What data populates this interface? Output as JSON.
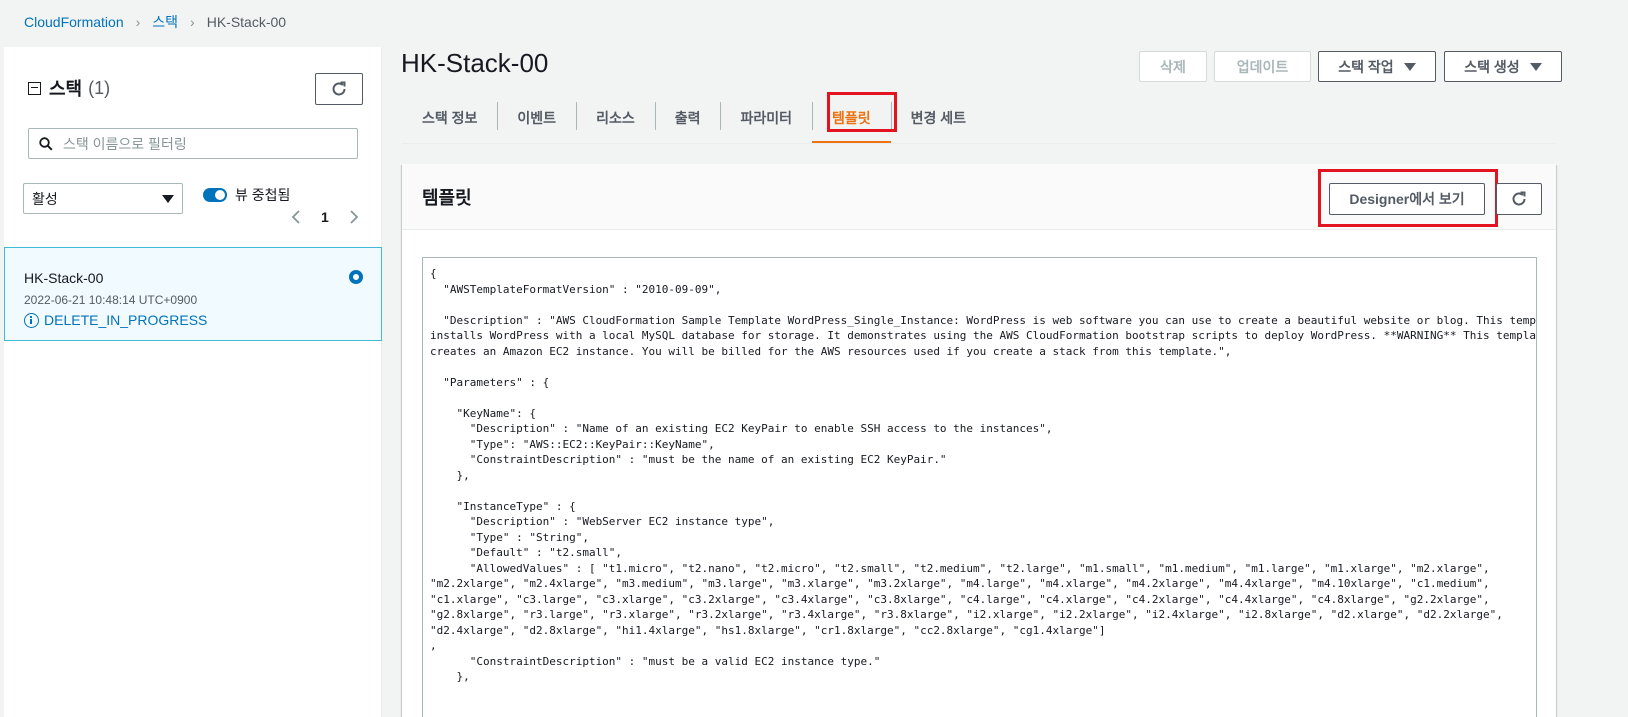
{
  "breadcrumb": {
    "root": "CloudFormation",
    "stacks": "스택",
    "current": "HK-Stack-00"
  },
  "left_panel": {
    "title": "스택",
    "count": "(1)",
    "search_placeholder": "스택 이름으로 필터링",
    "filter_select": "활성",
    "toggle_label": "뷰 중첩됨",
    "toggle_on": true,
    "page_number": "1",
    "stack": {
      "name": "HK-Stack-00",
      "date": "2022-06-21 10:48:14 UTC+0900",
      "status": "DELETE_IN_PROGRESS",
      "selected": true
    }
  },
  "main": {
    "title": "HK-Stack-00",
    "buttons": {
      "delete": "삭제",
      "update": "업데이트",
      "stack_actions": "스택 작업",
      "create_stack": "스택 생성"
    },
    "tabs": [
      {
        "label": "스택 정보"
      },
      {
        "label": "이벤트"
      },
      {
        "label": "리소스"
      },
      {
        "label": "출력"
      },
      {
        "label": "파라미터"
      },
      {
        "label": "템플릿",
        "active": true
      },
      {
        "label": "변경 세트"
      }
    ],
    "template": {
      "title": "템플릿",
      "designer_button": "Designer에서 보기",
      "code_lines": [
        "{",
        "  \"AWSTemplateFormatVersion\" : \"2010-09-09\",",
        "",
        "  \"Description\" : \"AWS CloudFormation Sample Template WordPress_Single_Instance: WordPress is web software you can use to create a beautiful website or blog. This template",
        "installs WordPress with a local MySQL database for storage. It demonstrates using the AWS CloudFormation bootstrap scripts to deploy WordPress. **WARNING** This template",
        "creates an Amazon EC2 instance. You will be billed for the AWS resources used if you create a stack from this template.\",",
        "",
        "  \"Parameters\" : {",
        "",
        "    \"KeyName\": {",
        "      \"Description\" : \"Name of an existing EC2 KeyPair to enable SSH access to the instances\",",
        "      \"Type\": \"AWS::EC2::KeyPair::KeyName\",",
        "      \"ConstraintDescription\" : \"must be the name of an existing EC2 KeyPair.\"",
        "    },",
        "",
        "    \"InstanceType\" : {",
        "      \"Description\" : \"WebServer EC2 instance type\",",
        "      \"Type\" : \"String\",",
        "      \"Default\" : \"t2.small\",",
        "      \"AllowedValues\" : [ \"t1.micro\", \"t2.nano\", \"t2.micro\", \"t2.small\", \"t2.medium\", \"t2.large\", \"m1.small\", \"m1.medium\", \"m1.large\", \"m1.xlarge\", \"m2.xlarge\",",
        "\"m2.2xlarge\", \"m2.4xlarge\", \"m3.medium\", \"m3.large\", \"m3.xlarge\", \"m3.2xlarge\", \"m4.large\", \"m4.xlarge\", \"m4.2xlarge\", \"m4.4xlarge\", \"m4.10xlarge\", \"c1.medium\",",
        "\"c1.xlarge\", \"c3.large\", \"c3.xlarge\", \"c3.2xlarge\", \"c3.4xlarge\", \"c3.8xlarge\", \"c4.large\", \"c4.xlarge\", \"c4.2xlarge\", \"c4.4xlarge\", \"c4.8xlarge\", \"g2.2xlarge\",",
        "\"g2.8xlarge\", \"r3.large\", \"r3.xlarge\", \"r3.2xlarge\", \"r3.4xlarge\", \"r3.8xlarge\", \"i2.xlarge\", \"i2.2xlarge\", \"i2.4xlarge\", \"i2.8xlarge\", \"d2.xlarge\", \"d2.2xlarge\",",
        "\"d2.4xlarge\", \"d2.8xlarge\", \"hi1.4xlarge\", \"hs1.8xlarge\", \"cr1.8xlarge\", \"cc2.8xlarge\", \"cg1.4xlarge\"]",
        ",",
        "      \"ConstraintDescription\" : \"must be a valid EC2 instance type.\"",
        "    },"
      ]
    }
  },
  "colors": {
    "link": "#0073bb",
    "active_tab": "#ec7211",
    "highlight": "#e3131f"
  }
}
